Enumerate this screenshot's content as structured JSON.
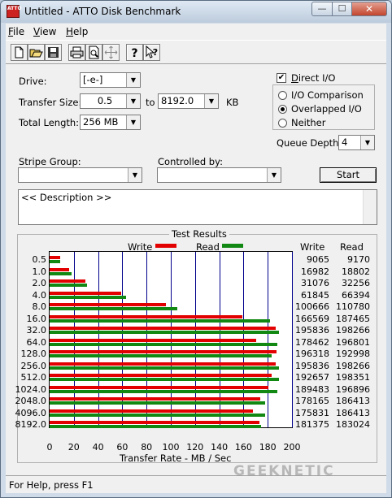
{
  "window": {
    "title": "Untitled - ATTO Disk Benchmark",
    "icon_text": "ATTO",
    "minimize": "—",
    "maximize": "☐",
    "close": "✕"
  },
  "menu": [
    {
      "label": "File",
      "accel": "F",
      "rest": "ile"
    },
    {
      "label": "View",
      "accel": "V",
      "rest": "iew"
    },
    {
      "label": "Help",
      "accel": "H",
      "rest": "elp"
    }
  ],
  "toolbar": [
    "new-icon",
    "open-icon",
    "save-icon",
    "print-icon",
    "print-preview-icon",
    "move-icon",
    "help-icon",
    "context-help-icon"
  ],
  "form": {
    "drive_label": "Drive:",
    "drive_value": "[-e-]",
    "transfer_size_label": "Transfer Size:",
    "transfer_from": "0.5",
    "to_label": "to",
    "transfer_to": "8192.0",
    "kb_label": "KB",
    "total_length_label": "Total Length:",
    "total_length_value": "256 MB",
    "direct_io_label": "Direct I/O",
    "direct_io_checked": true,
    "io_comparison_label": "I/O Comparison",
    "overlapped_io_label": "Overlapped I/O",
    "neither_label": "Neither",
    "io_mode_selected": "Overlapped I/O",
    "queue_depth_label": "Queue Depth:",
    "queue_depth_value": "4",
    "stripe_group_label": "Stripe Group:",
    "stripe_group_value": "",
    "controlled_by_label": "Controlled by:",
    "controlled_by_value": "",
    "start_button": "Start",
    "description": "<< Description >>"
  },
  "chart_data": {
    "type": "bar",
    "orientation": "horizontal",
    "title": "Test Results",
    "xlabel": "Transfer Rate - MB / Sec",
    "xlim": [
      0,
      200
    ],
    "xticks": [
      "0",
      "20",
      "40",
      "60",
      "80",
      "100",
      "120",
      "140",
      "160",
      "180",
      "200"
    ],
    "legend": [
      "Write",
      "Read"
    ],
    "column_headers": [
      "Write",
      "Read"
    ],
    "colors": {
      "write": "#e30000",
      "read": "#118811"
    },
    "categories": [
      "0.5",
      "1.0",
      "2.0",
      "4.0",
      "8.0",
      "16.0",
      "32.0",
      "64.0",
      "128.0",
      "256.0",
      "512.0",
      "1024.0",
      "2048.0",
      "4096.0",
      "8192.0"
    ],
    "series": [
      {
        "name": "Write",
        "values": [
          8.6,
          16.2,
          29.6,
          59.0,
          96.0,
          159.0,
          186.8,
          170.2,
          187.1,
          186.8,
          183.4,
          180.7,
          173.7,
          167.7,
          173.0
        ]
      },
      {
        "name": "Read",
        "values": [
          8.7,
          17.9,
          30.8,
          63.3,
          105.6,
          181.9,
          189.1,
          187.8,
          183.4,
          189.1,
          189.2,
          187.8,
          177.8,
          177.8,
          174.8
        ]
      }
    ],
    "write_text": [
      "9065",
      "16982",
      "31076",
      "61845",
      "100666",
      "166569",
      "195836",
      "178462",
      "196318",
      "195836",
      "192657",
      "189483",
      "178165",
      "175831",
      "181375"
    ],
    "read_text": [
      "9170",
      "18802",
      "32256",
      "66394",
      "110780",
      "187465",
      "198266",
      "196801",
      "192998",
      "198266",
      "198351",
      "196896",
      "186413",
      "186413",
      "183024"
    ]
  },
  "status": {
    "text": "For Help, press F1"
  },
  "watermark": "GEEKNETIC"
}
